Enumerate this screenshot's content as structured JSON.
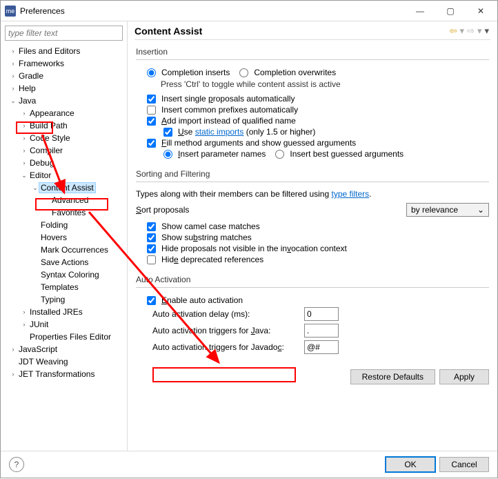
{
  "window": {
    "title": "Preferences"
  },
  "sidebar": {
    "filter_placeholder": "type filter text",
    "items": [
      {
        "label": "Files and Editors",
        "expandable": true,
        "depth": 0
      },
      {
        "label": "Frameworks",
        "expandable": true,
        "depth": 0
      },
      {
        "label": "Gradle",
        "expandable": true,
        "depth": 0
      },
      {
        "label": "Help",
        "expandable": true,
        "depth": 0
      },
      {
        "label": "Java",
        "expandable": true,
        "depth": 0,
        "expanded": true
      },
      {
        "label": "Appearance",
        "expandable": true,
        "depth": 1
      },
      {
        "label": "Build Path",
        "expandable": true,
        "depth": 1
      },
      {
        "label": "Code Style",
        "expandable": true,
        "depth": 1
      },
      {
        "label": "Compiler",
        "expandable": true,
        "depth": 1
      },
      {
        "label": "Debug",
        "expandable": true,
        "depth": 1
      },
      {
        "label": "Editor",
        "expandable": true,
        "depth": 1,
        "expanded": true
      },
      {
        "label": "Content Assist",
        "expandable": true,
        "depth": 2,
        "expanded": true,
        "selected": true
      },
      {
        "label": "Advanced",
        "expandable": false,
        "depth": 3
      },
      {
        "label": "Favorites",
        "expandable": false,
        "depth": 3
      },
      {
        "label": "Folding",
        "expandable": false,
        "depth": 2
      },
      {
        "label": "Hovers",
        "expandable": false,
        "depth": 2
      },
      {
        "label": "Mark Occurrences",
        "expandable": false,
        "depth": 2
      },
      {
        "label": "Save Actions",
        "expandable": false,
        "depth": 2
      },
      {
        "label": "Syntax Coloring",
        "expandable": false,
        "depth": 2
      },
      {
        "label": "Templates",
        "expandable": false,
        "depth": 2
      },
      {
        "label": "Typing",
        "expandable": false,
        "depth": 2
      },
      {
        "label": "Installed JREs",
        "expandable": true,
        "depth": 1
      },
      {
        "label": "JUnit",
        "expandable": true,
        "depth": 1
      },
      {
        "label": "Properties Files Editor",
        "expandable": false,
        "depth": 1
      },
      {
        "label": "JavaScript",
        "expandable": true,
        "depth": 0
      },
      {
        "label": "JDT Weaving",
        "expandable": false,
        "depth": 0
      },
      {
        "label": "JET Transformations",
        "expandable": true,
        "depth": 0
      }
    ]
  },
  "main": {
    "title": "Content Assist",
    "insertion": {
      "heading": "Insertion",
      "completion_inserts": "Completion inserts",
      "completion_overwrites": "Completion overwrites",
      "toggle_hint": "Press 'Ctrl' to toggle while content assist is active",
      "insert_single_pre": "Insert single ",
      "insert_single_u": "p",
      "insert_single_post": "roposals automatically",
      "insert_prefixes": "Insert common prefixes automatically",
      "add_import_pre": "",
      "add_import_u": "A",
      "add_import_post": "dd import instead of qualified name",
      "use_pre": "",
      "use_u": "U",
      "use_post": "se ",
      "static_imports": "static imports",
      "use_suffix": " (only 1.5 or higher)",
      "fill_pre": "",
      "fill_u": "F",
      "fill_post": "ill method arguments and show guessed arguments",
      "insert_param_pre": "",
      "insert_param_u": "I",
      "insert_param_post": "nsert parameter names",
      "insert_best": "Insert best guessed arguments"
    },
    "sorting": {
      "heading": "Sorting and Filtering",
      "hint_pre": "Types along with their members can be filtered using ",
      "type_filters": "type filters",
      "hint_post": ".",
      "sort_label_u": "S",
      "sort_label": "ort proposals",
      "sort_value": "by relevance",
      "camel": "Show camel case matches",
      "substring_pre": "Show su",
      "substring_u": "b",
      "substring_post": "string matches",
      "hide_pre": "Hide proposals not visible in the in",
      "hide_u": "v",
      "hide_post": "ocation context",
      "deprecated_pre": "Hid",
      "deprecated_u": "e",
      "deprecated_post": " deprecated references"
    },
    "auto": {
      "heading": "Auto Activation",
      "enable_pre": "",
      "enable_u": "E",
      "enable_post": "nable auto activation",
      "delay_label": "Auto activation delay (ms):",
      "delay_value": "0",
      "java_label_pre": "Auto activation triggers for ",
      "java_label_u": "J",
      "java_label_post": "ava:",
      "java_value": ".",
      "javadoc_label_pre": "Auto activation triggers for Javado",
      "javadoc_label_u": "c",
      "javadoc_label_post": ":",
      "javadoc_value": "@#"
    }
  },
  "buttons": {
    "restore": "Restore Defaults",
    "apply": "Apply",
    "ok": "OK",
    "cancel": "Cancel"
  }
}
